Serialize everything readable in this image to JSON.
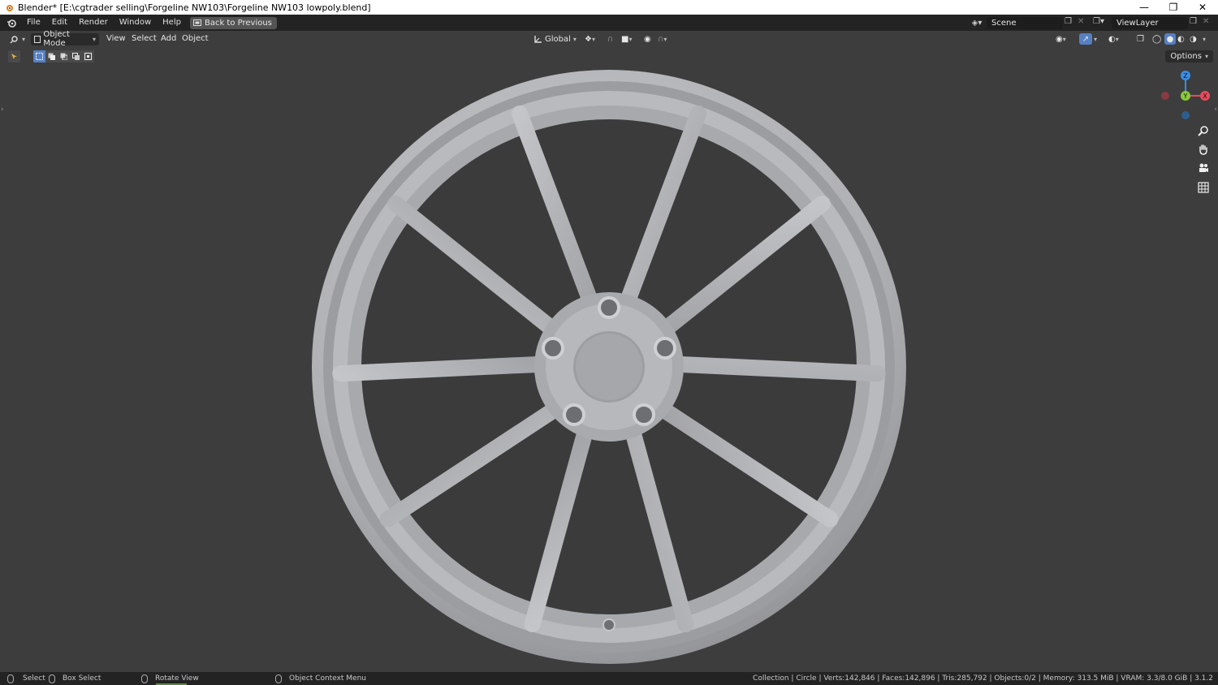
{
  "window": {
    "title": "Blender* [E:\\cgtrader selling\\Forgeline NW103\\Forgeline NW103 lowpoly.blend]",
    "minimize_icon": "minimize-icon",
    "maximize_icon": "restore-icon",
    "close_icon": "close-icon"
  },
  "topbar": {
    "menus": [
      "File",
      "Edit",
      "Render",
      "Window",
      "Help"
    ],
    "back_button": "Back to Previous",
    "scene_label": "Scene",
    "view_layer_label": "ViewLayer"
  },
  "viewport_header": {
    "mode": "Object Mode",
    "menus": [
      "View",
      "Select",
      "Add",
      "Object"
    ],
    "orientation": "Global",
    "options": "Options"
  },
  "gizmo": {
    "z_label": "Z",
    "y_label": "Y",
    "x_label": "X",
    "colors": {
      "x": "#e84b5d",
      "y": "#8ac83c",
      "z": "#3b8ee3"
    }
  },
  "nav_icons": [
    "zoom-icon",
    "pan-hand-icon",
    "camera-icon",
    "grid-perspective-icon"
  ],
  "status_bar": {
    "select": "Select",
    "box_select": "Box Select",
    "rotate_view": "Rotate View",
    "context_menu": "Object Context Menu",
    "stats": "Collection | Circle | Verts:142,846 | Faces:142,896 | Tris:285,792 | Objects:0/2 | Memory: 313.5 MiB | VRAM: 3.3/8.0 GiB | 3.1.2"
  },
  "colors": {
    "viewport_bg": "#3d3d3d",
    "header_bg": "#232323",
    "wheel": "#b4b5b9",
    "active_blue": "#5680c2"
  }
}
